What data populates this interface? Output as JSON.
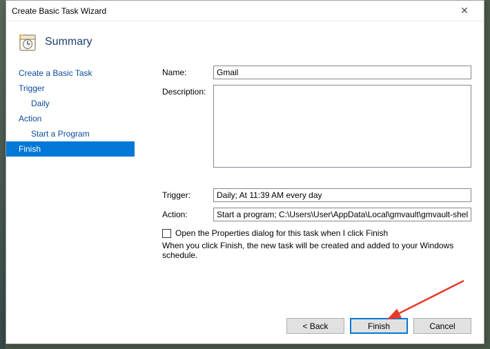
{
  "window": {
    "title": "Create Basic Task Wizard",
    "close_glyph": "✕"
  },
  "header": {
    "title": "Summary"
  },
  "sidebar": {
    "items": [
      {
        "label": "Create a Basic Task",
        "indent": false,
        "selected": false
      },
      {
        "label": "Trigger",
        "indent": false,
        "selected": false
      },
      {
        "label": "Daily",
        "indent": true,
        "selected": false
      },
      {
        "label": "Action",
        "indent": false,
        "selected": false
      },
      {
        "label": "Start a Program",
        "indent": true,
        "selected": false
      },
      {
        "label": "Finish",
        "indent": false,
        "selected": true
      }
    ]
  },
  "form": {
    "name_label": "Name:",
    "name_value": "Gmail",
    "description_label": "Description:",
    "description_value": "",
    "trigger_label": "Trigger:",
    "trigger_value": "Daily; At 11:39 AM every day",
    "action_label": "Action:",
    "action_value": "Start a program; C:\\Users\\User\\AppData\\Local\\gmvault\\gmvault-shell.bat sy",
    "checkbox_label": "Open the Properties dialog for this task when I click Finish",
    "checkbox_checked": false,
    "note": "When you click Finish, the new task will be created and added to your Windows schedule."
  },
  "buttons": {
    "back": "< Back",
    "finish": "Finish",
    "cancel": "Cancel"
  }
}
